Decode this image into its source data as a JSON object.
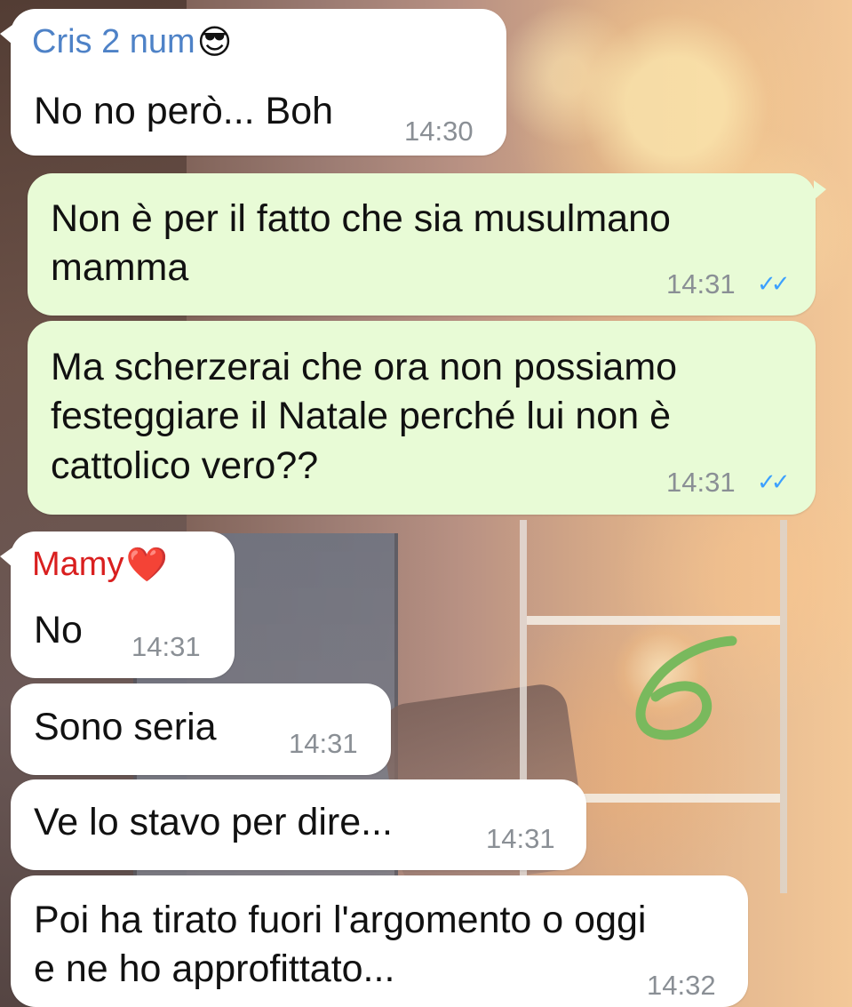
{
  "messages": [
    {
      "type": "incoming",
      "sender_name": "Cris 2 num",
      "sender_emoji": "😎",
      "sender_color": "#4e82c7",
      "text": "No no però... Boh",
      "time": "14:30"
    },
    {
      "type": "outgoing",
      "text": "Non è per il fatto che sia musulmano\nmamma",
      "time": "14:31",
      "status_icon": "double-check-icon"
    },
    {
      "type": "outgoing",
      "text": "Ma scherzerai che ora non possiamo\nfesteggiare il Natale perché lui non è\ncattolico vero??",
      "time": "14:31",
      "status_icon": "double-check-icon"
    },
    {
      "type": "incoming",
      "sender_name": "Mamy",
      "sender_emoji": "❤️",
      "sender_color": "#d91f1f",
      "text": "No",
      "time": "14:31"
    },
    {
      "type": "incoming",
      "text": "Sono seria",
      "time": "14:31"
    },
    {
      "type": "incoming",
      "text": "Ve lo stavo per dire...",
      "time": "14:31"
    },
    {
      "type": "incoming",
      "text": "Poi ha tirato fuori l'argomento o oggi\ne ne ho approfittato...",
      "time": "14:32"
    }
  ],
  "annotation_mark": {
    "icon": "handwritten-six-icon",
    "color": "#79b95d"
  },
  "colors": {
    "outgoing_bubble": "#e8fbd6",
    "incoming_bubble": "#ffffff",
    "timestamp": "#8a8f95",
    "read_receipt": "#3ca0ff"
  }
}
